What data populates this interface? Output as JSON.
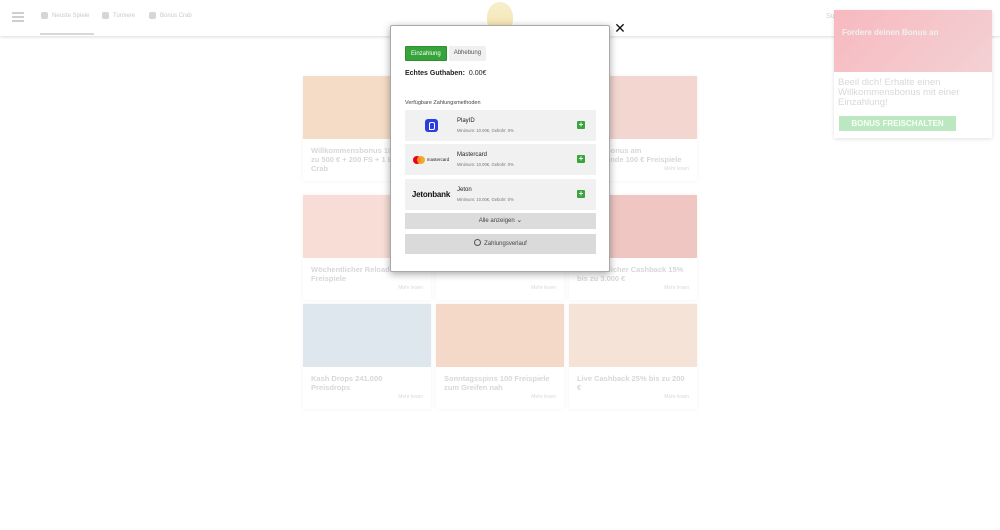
{
  "background": {
    "nav": [
      {
        "label": "Neuste Spiele"
      },
      {
        "label": "Turniere"
      },
      {
        "label": "Bonus Crab"
      }
    ],
    "search_label": "Suche",
    "promos": [
      {
        "title": "Willkommensbonus 100% bis zu 500 € + 200 FS + 1 Bonus Crab",
        "more": "",
        "color": "#f5dcc7"
      },
      {
        "title": "",
        "more": "",
        "color": "#f3e7d6"
      },
      {
        "title": "Wochenbonus am Wochenende 100 € Freispiele",
        "more": "Mehr lesen",
        "color": "#f3d6cf"
      },
      {
        "title": "Wöchentlicher Reload 50 Freispiele",
        "more": "Mehr lesen",
        "color": "#f7ddd6"
      },
      {
        "title": "",
        "more": "Mehr lesen",
        "color": "#f6e9e7"
      },
      {
        "title": "Wöchentlicher Cashback 15% bis zu 3.000 €",
        "more": "Mehr lesen",
        "color": "#f0c6c2"
      },
      {
        "title": "Kash Drops 241.000 Preisdrops",
        "more": "Mehr lesen",
        "color": "#dfe7ee"
      },
      {
        "title": "Sonntagsspins 100 Freispiele zum Greifen nah",
        "more": "Mehr lesen",
        "color": "#f5d9c8"
      },
      {
        "title": "Live Cashback 25% bis zu 200 €",
        "more": "Mehr lesen",
        "color": "#f6e3d7"
      }
    ],
    "bonus": {
      "image_text": "Fordere deinen Bonus an",
      "text": "Beeil dich! Erhalte einen Willkommensbonus mit einer Einzahlung!",
      "button": "BONUS FREISCHALTEN",
      "close": "×"
    }
  },
  "modal": {
    "close": "✕",
    "tabs": [
      {
        "label": "Einzahlung",
        "active": true
      },
      {
        "label": "Abhebung",
        "active": false
      }
    ],
    "balance_label": "Echtes Guthaben:",
    "balance_value": "0.00€",
    "methods_title": "Verfügbare Zahlungsmethoden",
    "methods": [
      {
        "name": "PlayID",
        "info": "Minimum: 10.00€, Gebühr: 0%",
        "logo": "playid-icon",
        "add": "+"
      },
      {
        "name": "Mastercard",
        "info": "Minimum: 10.00€, Gebühr: 0%",
        "logo": "mastercard-icon",
        "logo_text": "mastercard",
        "add": "+"
      },
      {
        "name": "Jeton",
        "info": "Minimum: 10.00€, Gebühr: 0%",
        "logo": "jetonbank-icon",
        "logo_text": "Jetonbank",
        "add": "+"
      }
    ],
    "show_all": "Alle anzeigen",
    "show_all_chevron": "⌄",
    "history": "Zahlungsverlauf",
    "accent": "#37a33b"
  }
}
